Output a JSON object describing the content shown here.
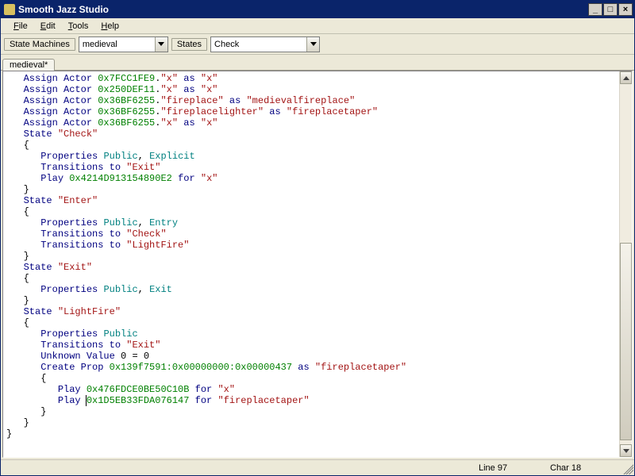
{
  "window": {
    "title": "Smooth Jazz Studio"
  },
  "menu": {
    "file": "File",
    "edit": "Edit",
    "tools": "Tools",
    "help": "Help"
  },
  "toolbar": {
    "label_state_machines": "State Machines",
    "combo_state_machines_value": "medieval",
    "label_states": "States",
    "combo_states_value": "Check"
  },
  "tabs": {
    "active": "medieval*"
  },
  "status": {
    "line_label": "Line 97",
    "char_label": "Char 18"
  },
  "code": {
    "abbrev": {
      "aa": "Assign Actor",
      "as": "as",
      "st": "State",
      "pr": "Properties",
      "tr": "Transitions",
      "to": "to",
      "pl": "Play",
      "for": "for",
      "uv": "Unknown Value",
      "cp": "Create Prop",
      "pub": "Public",
      "exp": "Explicit",
      "ent": "Entry",
      "exi": "Exit"
    },
    "l1": {
      "hex": "0x7FCC1FE9",
      "s1": "\"x\"",
      "s2": "\"x\""
    },
    "l2": {
      "hex": "0x250DEF11",
      "s1": "\"x\"",
      "s2": "\"x\""
    },
    "l3": {
      "hex": "0x36BF6255",
      "s1": "\"fireplace\"",
      "s2": "\"medievalfireplace\""
    },
    "l4": {
      "hex": "0x36BF6255",
      "s1": "\"fireplacelighter\"",
      "s2": "\"fireplacetaper\""
    },
    "l5": {
      "hex": "0x36BF6255",
      "s1": "\"x\"",
      "s2": "\"x\""
    },
    "st1": {
      "name": "\"Check\"",
      "tr1": "\"Exit\"",
      "play_hex": "0x4214D913154890E2",
      "play_for": "\"x\""
    },
    "st2": {
      "name": "\"Enter\"",
      "tr1": "\"Check\"",
      "tr2": "\"LightFire\""
    },
    "st3": {
      "name": "\"Exit\""
    },
    "st4": {
      "name": "\"LightFire\"",
      "tr1": "\"Exit\"",
      "unknown": "0 = 0",
      "cp_hex": "0x139f7591:0x00000000:0x00000437",
      "cp_as": "\"fireplacetaper\"",
      "play1_hex": "0x476FDCE0BE50C10B",
      "play1_for": "\"x\"",
      "play2_hex": "0x1D5EB33FDA076147",
      "play2_for": "\"fireplacetaper\""
    }
  },
  "scrollbar": {
    "thumb_top_pct": 44,
    "thumb_height_pct": 55
  }
}
